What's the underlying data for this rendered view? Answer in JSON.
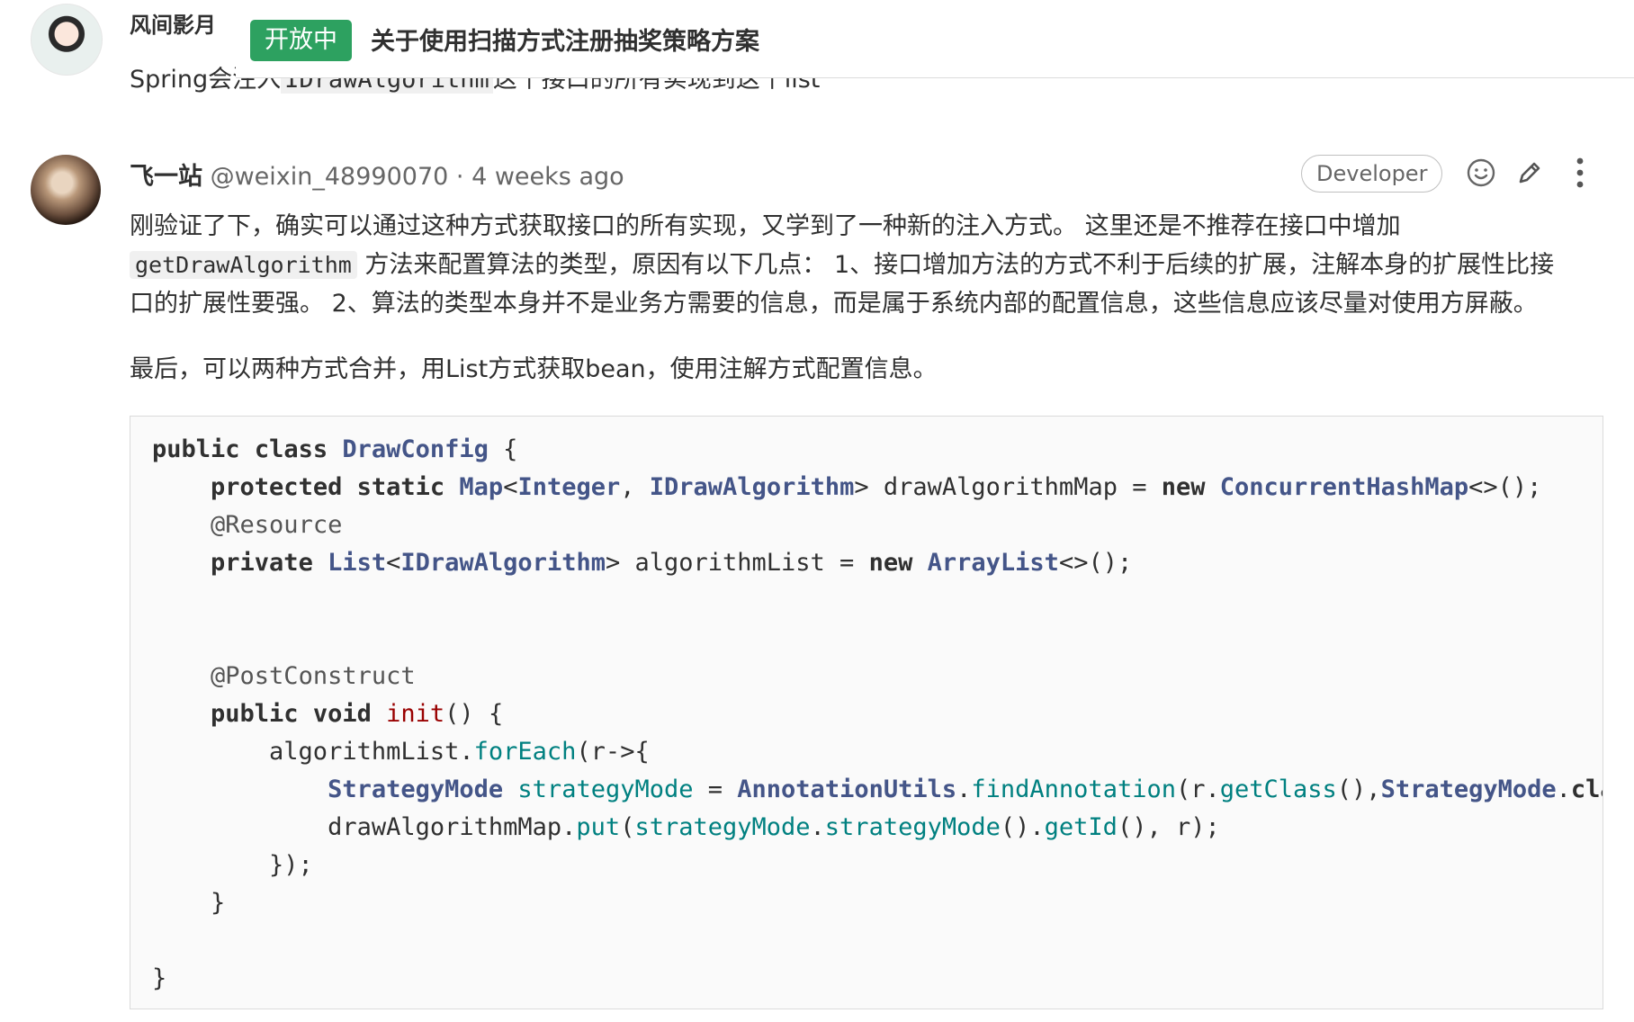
{
  "previous_note": {
    "author": "风间影月",
    "body_start": "Spring会注入",
    "body_code": "IDrawAlgorithm",
    "body_end": "这个接口的所有实现到这个list"
  },
  "issue_header": {
    "status": "开放中",
    "title": "关于使用扫描方式注册抽奖策略方案",
    "status_color": "#2da160"
  },
  "note": {
    "author_name": "飞一站",
    "author_handle": "@weixin_48990070",
    "separator": "·",
    "time": "4 weeks ago",
    "role_badge": "Developer",
    "actions": [
      "smiley-icon",
      "pencil-icon",
      "more-vertical-icon"
    ],
    "paragraph1_line1": "刚验证了下，确实可以通过这种方式获取接口的所有实现，又学到了一种新的注入方式。 这里还是不推荐在接口中增加",
    "paragraph1_code": "getDrawAlgorithm",
    "paragraph1_line2": "方法来配置算法的类型，原因有以下几点： 1、接口增加方法的方式不利于后续的扩展，注解本身的扩展性比接",
    "paragraph1_line3": "口的扩展性要强。 2、算法的类型本身并不是业务方需要的信息，而是属于系统内部的配置信息，这些信息应该尽量对使用方屏蔽。",
    "paragraph2": "最后，可以两种方式合并，用List方式获取bean，使用注解方式配置信息。"
  },
  "code": {
    "language": "java",
    "lines": [
      "public class DrawConfig {",
      "    protected static Map<Integer, IDrawAlgorithm> drawAlgorithmMap = new ConcurrentHashMap<>();",
      "    @Resource",
      "    private List<IDrawAlgorithm> algorithmList = new ArrayList<>();",
      "",
      "",
      "    @PostConstruct",
      "    public void init() {",
      "        algorithmList.forEach(r->{",
      "            StrategyMode strategyMode = AnnotationUtils.findAnnotation(r.getClass(),StrategyMode.class)",
      "            drawAlgorithmMap.put(strategyMode.strategyMode().getId(), r);",
      "        });",
      "    }",
      "",
      "}"
    ]
  }
}
